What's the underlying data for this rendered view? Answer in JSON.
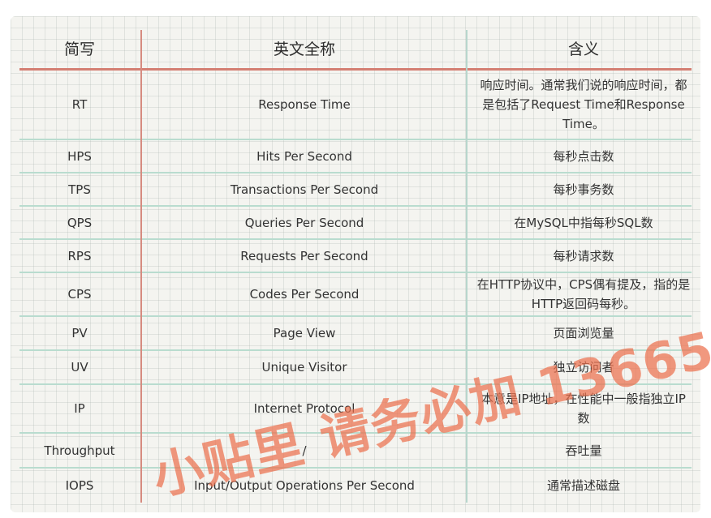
{
  "table": {
    "headers": [
      "简写",
      "英文全称",
      "含义"
    ],
    "rows": [
      [
        "RT",
        "Response Time",
        "响应时间。通常我们说的响应时间，都是包括了Request Time和Response Time。"
      ],
      [
        "HPS",
        "Hits Per Second",
        "每秒点击数"
      ],
      [
        "TPS",
        "Transactions Per Second",
        "每秒事务数"
      ],
      [
        "QPS",
        "Queries Per Second",
        "在MySQL中指每秒SQL数"
      ],
      [
        "RPS",
        "Requests Per Second",
        "每秒请求数"
      ],
      [
        "CPS",
        "Codes Per Second",
        "在HTTP协议中，CPS偶有提及，指的是HTTP返回码每秒。"
      ],
      [
        "PV",
        "Page View",
        "页面浏览量"
      ],
      [
        "UV",
        "Unique Visitor",
        "独立访问者"
      ],
      [
        "IP",
        "Internet Protocol",
        "本意是IP地址，在性能中一般指独立IP数"
      ],
      [
        "Throughput",
        "/",
        "吞吐量"
      ],
      [
        "IOPS",
        "Input/Output Operations Per Second",
        "通常描述磁盘"
      ]
    ]
  },
  "watermark": {
    "text": "小贴里 请务必加 13665"
  }
}
